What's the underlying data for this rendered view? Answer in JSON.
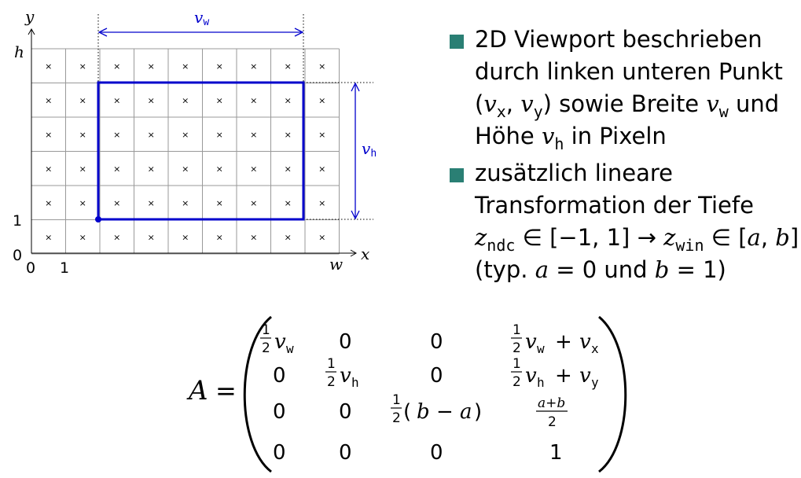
{
  "diagram": {
    "axis_x": "x",
    "axis_y": "y",
    "label_w": "w",
    "label_h": "h",
    "label_0_x": "0",
    "label_1_x": "1",
    "label_0_y": "0",
    "label_1_y": "1",
    "vw_var": "v",
    "vw_sub": "w",
    "vh_var": "v",
    "vh_sub": "h",
    "cell_marker": "×",
    "grid_cols": 9,
    "grid_rows": 6,
    "viewport_cols": [
      2,
      8
    ],
    "viewport_rows": [
      1,
      5
    ],
    "colors": {
      "grid": "#999999",
      "viewport": "#0000cc",
      "bullet": "#2a7f74"
    }
  },
  "bullets": [
    {
      "lines": {
        "l1": "2D Viewport beschrieben",
        "l2": "durch linken unteren Punkt",
        "l3_a": "(",
        "l3_vx": "v",
        "l3_vx_sub": "x",
        "l3_comma": ", ",
        "l3_vy": "v",
        "l3_vy_sub": "y",
        "l3_b": ") sowie Breite ",
        "l3_vw": "v",
        "l3_vw_sub": "w",
        "l3_c": " und",
        "l4_a": "Höhe ",
        "l4_vh": "v",
        "l4_vh_sub": "h",
        "l4_b": " in Pixeln"
      }
    },
    {
      "lines": {
        "l1": "zusätzlich lineare",
        "l2": "Transformation der Tiefe",
        "l3_z1": "z",
        "l3_z1_sub": "ndc",
        "l3_a": " ∈ [−1, 1] → ",
        "l3_z2": "z",
        "l3_z2_sub": "win",
        "l3_b": " ∈ [",
        "l3_avar": "a",
        "l3_c": ", ",
        "l3_bvar": "b",
        "l3_d": "]",
        "l4_a": "(typ. ",
        "l4_avar": "a",
        "l4_b": " = 0 und ",
        "l4_bvar": "b",
        "l4_c": " = 1)"
      }
    }
  ],
  "matrix": {
    "lhs": "A",
    "eq": "=",
    "half": "1",
    "two": "2",
    "v": "v",
    "sub_w": "w",
    "sub_h": "h",
    "sub_x": "x",
    "sub_y": "y",
    "zero": "0",
    "one": "1",
    "plus": "+",
    "minus": "−",
    "b_open": "(",
    "b_close": ")",
    "a_var": "a",
    "b_var": "b",
    "aplusb": "a+b"
  }
}
